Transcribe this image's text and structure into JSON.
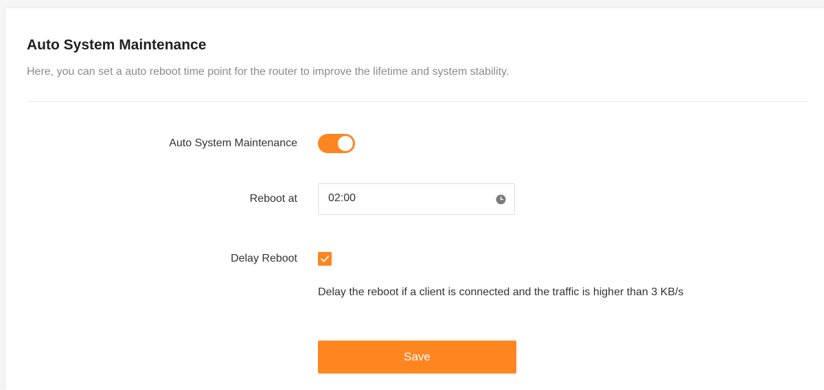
{
  "section": {
    "title": "Auto System Maintenance",
    "description": "Here, you can set a auto reboot time point for the router to improve the lifetime and system stability."
  },
  "form": {
    "auto_maintenance": {
      "label": "Auto System Maintenance",
      "enabled": true
    },
    "reboot_at": {
      "label": "Reboot at",
      "value": "02:00",
      "icon": "clock-icon"
    },
    "delay_reboot": {
      "label": "Delay Reboot",
      "checked": true,
      "hint": "Delay the reboot if a client is connected and the traffic is higher than 3 KB/s"
    },
    "save_label": "Save"
  },
  "colors": {
    "accent": "#ff8521",
    "muted_text": "#8a8a8a",
    "text": "#333333"
  }
}
